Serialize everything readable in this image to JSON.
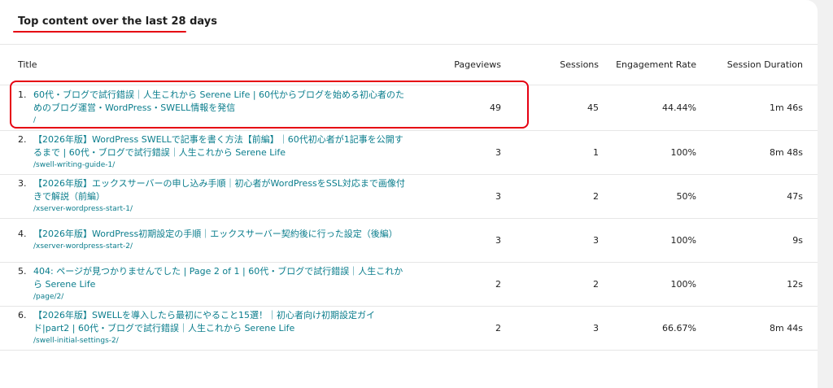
{
  "card": {
    "title": "Top content over the last 28 days"
  },
  "table": {
    "headers": {
      "title": "Title",
      "pageviews": "Pageviews",
      "sessions": "Sessions",
      "engagement_rate": "Engagement Rate",
      "session_duration": "Session Duration"
    },
    "rows": [
      {
        "rank": "1.",
        "title": "60代・ブログで試行錯誤｜人生これから Serene Life | 60代からブログを始める初心者のためのブログ運営・WordPress・SWELL情報を発信",
        "path": "/",
        "pageviews": "49",
        "sessions": "45",
        "engagement_rate": "44.44%",
        "session_duration": "1m 46s"
      },
      {
        "rank": "2.",
        "title": "【2026年版】WordPress SWELLで記事を書く方法【前編】｜60代初心者が1記事を公開するまで | 60代・ブログで試行錯誤｜人生これから Serene Life",
        "path": "/swell-writing-guide-1/",
        "pageviews": "3",
        "sessions": "1",
        "engagement_rate": "100%",
        "session_duration": "8m 48s"
      },
      {
        "rank": "3.",
        "title": "【2026年版】エックスサーバーの申し込み手順｜初心者がWordPressをSSL対応まで画像付きで解説（前編）",
        "path": "/xserver-wordpress-start-1/",
        "pageviews": "3",
        "sessions": "2",
        "engagement_rate": "50%",
        "session_duration": "47s"
      },
      {
        "rank": "4.",
        "title": "【2026年版】WordPress初期設定の手順｜エックスサーバー契約後に行った設定（後編）",
        "path": "/xserver-wordpress-start-2/",
        "pageviews": "3",
        "sessions": "3",
        "engagement_rate": "100%",
        "session_duration": "9s"
      },
      {
        "rank": "5.",
        "title": "404: ページが見つかりませんでした | Page 2 of 1 | 60代・ブログで試行錯誤｜人生これから Serene Life",
        "path": "/page/2/",
        "pageviews": "2",
        "sessions": "2",
        "engagement_rate": "100%",
        "session_duration": "12s"
      },
      {
        "rank": "6.",
        "title": "【2026年版】SWELLを導入したら最初にやること15選！｜初心者向け初期設定ガイド|part2 | 60代・ブログで試行錯誤｜人生これから Serene Life",
        "path": "/swell-initial-settings-2/",
        "pageviews": "2",
        "sessions": "3",
        "engagement_rate": "66.67%",
        "session_duration": "8m 44s"
      }
    ]
  },
  "colors": {
    "link": "#0a7d8c",
    "annotation_red": "#e60012",
    "divider": "#e6e6e6"
  }
}
